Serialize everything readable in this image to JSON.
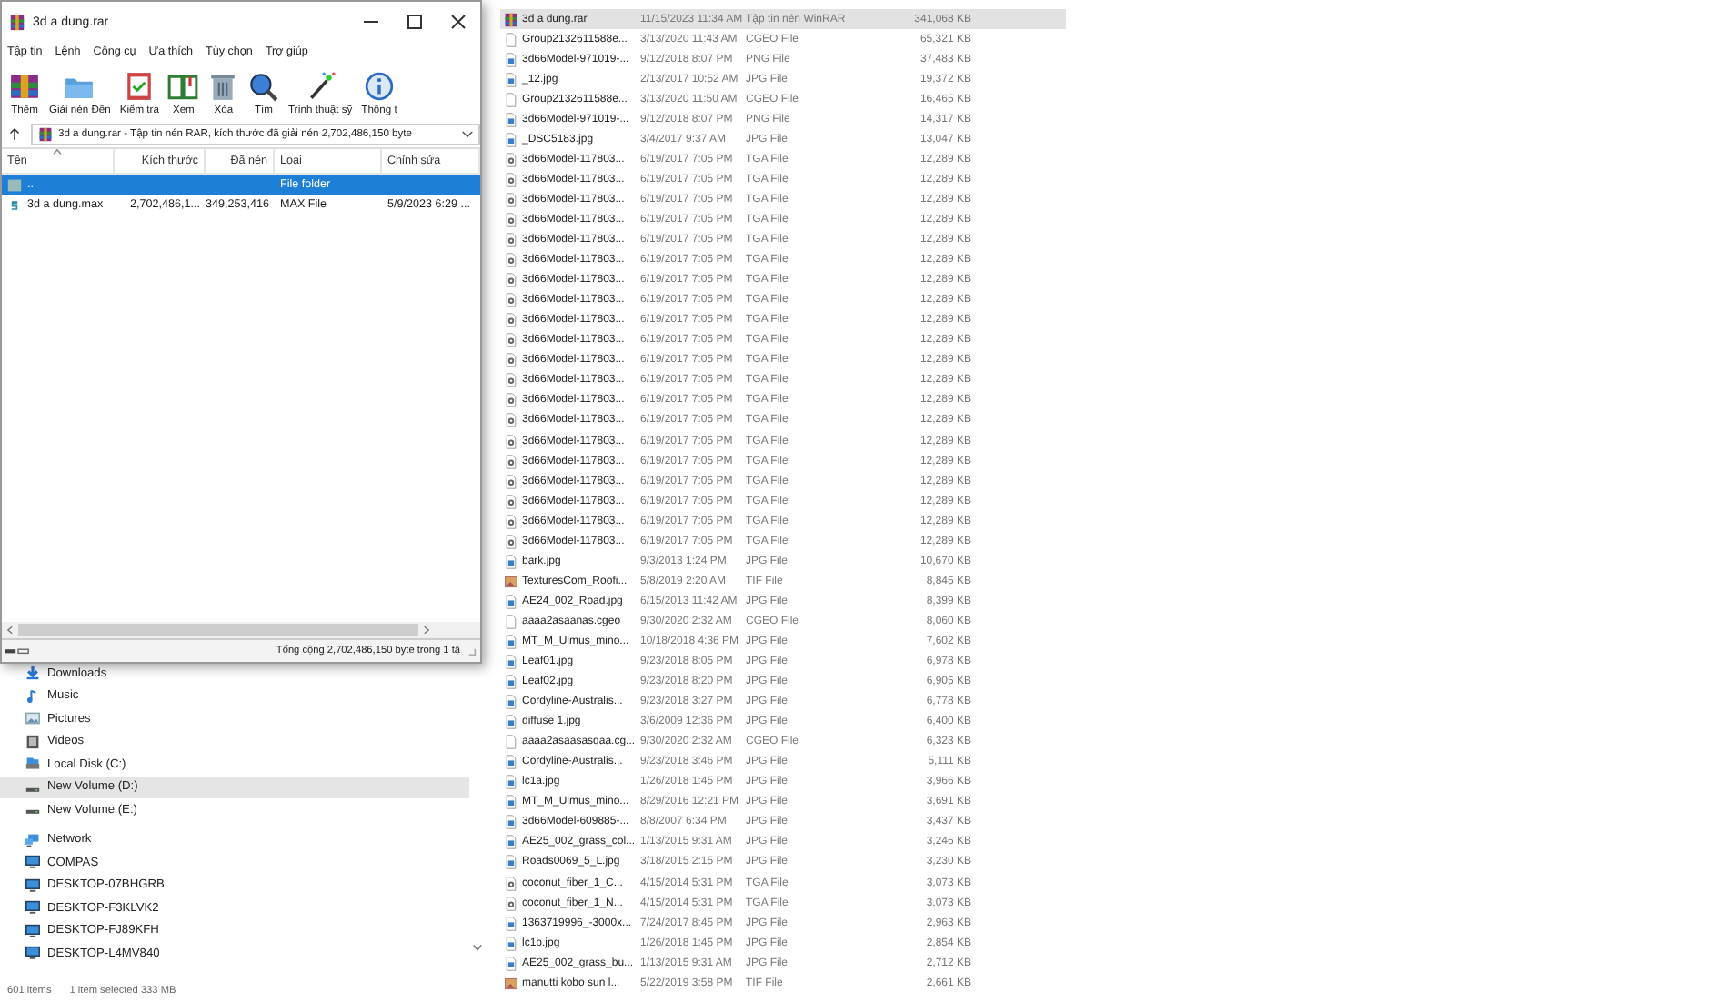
{
  "explorer": {
    "nav_items": [
      {
        "label": "Downloads",
        "kind": "download",
        "selected": false
      },
      {
        "label": "Music",
        "kind": "music",
        "selected": false
      },
      {
        "label": "Pictures",
        "kind": "pictures",
        "selected": false
      },
      {
        "label": "Videos",
        "kind": "videos",
        "selected": false
      },
      {
        "label": "Local Disk (C:)",
        "kind": "disk",
        "selected": false
      },
      {
        "label": "New Volume (D:)",
        "kind": "drive",
        "selected": true
      },
      {
        "label": "New Volume (E:)",
        "kind": "drive",
        "selected": false
      },
      {
        "label": "Network",
        "kind": "network",
        "selected": false,
        "children": [
          {
            "label": "COMPAS",
            "kind": "computer",
            "selected": false
          },
          {
            "label": "DESKTOP-07BHGRB",
            "kind": "computer",
            "selected": false
          },
          {
            "label": "DESKTOP-F3KLVK2",
            "kind": "computer",
            "selected": false
          },
          {
            "label": "DESKTOP-FJ89KFH",
            "kind": "computer",
            "selected": false
          },
          {
            "label": "DESKTOP-L4MV840",
            "kind": "computer",
            "selected": false
          }
        ]
      }
    ],
    "files": [
      {
        "name": "3d a dung.rar",
        "date": "11/15/2023 11:34 AM",
        "type": "Tập tin nén WinRAR",
        "size": "341,068 KB",
        "kind": "rar",
        "selected": true
      },
      {
        "name": "Group2132611588e...",
        "date": "3/13/2020 11:43 AM",
        "type": "CGEO File",
        "size": "65,321 KB",
        "kind": "blank",
        "selected": false
      },
      {
        "name": "3d66Model-971019-...",
        "date": "9/12/2018 8:07 PM",
        "type": "PNG File",
        "size": "37,483 KB",
        "kind": "image",
        "selected": false
      },
      {
        "name": "_12.jpg",
        "date": "2/13/2017 10:52 AM",
        "type": "JPG File",
        "size": "19,372 KB",
        "kind": "image",
        "selected": false
      },
      {
        "name": "Group2132611588e...",
        "date": "3/13/2020 11:50 AM",
        "type": "CGEO File",
        "size": "16,465 KB",
        "kind": "blank",
        "selected": false
      },
      {
        "name": "3d66Model-971019-...",
        "date": "9/12/2018 8:07 PM",
        "type": "PNG File",
        "size": "14,317 KB",
        "kind": "image",
        "selected": false
      },
      {
        "name": "_DSC5183.jpg",
        "date": "3/4/2017 9:37 AM",
        "type": "JPG File",
        "size": "13,047 KB",
        "kind": "image",
        "selected": false
      },
      {
        "name": "3d66Model-117803...",
        "date": "6/19/2017 7:05 PM",
        "type": "TGA File",
        "size": "12,289 KB",
        "kind": "tga",
        "selected": false
      },
      {
        "name": "3d66Model-117803...",
        "date": "6/19/2017 7:05 PM",
        "type": "TGA File",
        "size": "12,289 KB",
        "kind": "tga",
        "selected": false
      },
      {
        "name": "3d66Model-117803...",
        "date": "6/19/2017 7:05 PM",
        "type": "TGA File",
        "size": "12,289 KB",
        "kind": "tga",
        "selected": false
      },
      {
        "name": "3d66Model-117803...",
        "date": "6/19/2017 7:05 PM",
        "type": "TGA File",
        "size": "12,289 KB",
        "kind": "tga",
        "selected": false
      },
      {
        "name": "3d66Model-117803...",
        "date": "6/19/2017 7:05 PM",
        "type": "TGA File",
        "size": "12,289 KB",
        "kind": "tga",
        "selected": false
      },
      {
        "name": "3d66Model-117803...",
        "date": "6/19/2017 7:05 PM",
        "type": "TGA File",
        "size": "12,289 KB",
        "kind": "tga",
        "selected": false
      },
      {
        "name": "3d66Model-117803...",
        "date": "6/19/2017 7:05 PM",
        "type": "TGA File",
        "size": "12,289 KB",
        "kind": "tga",
        "selected": false
      },
      {
        "name": "3d66Model-117803...",
        "date": "6/19/2017 7:05 PM",
        "type": "TGA File",
        "size": "12,289 KB",
        "kind": "tga",
        "selected": false
      },
      {
        "name": "3d66Model-117803...",
        "date": "6/19/2017 7:05 PM",
        "type": "TGA File",
        "size": "12,289 KB",
        "kind": "tga",
        "selected": false
      },
      {
        "name": "3d66Model-117803...",
        "date": "6/19/2017 7:05 PM",
        "type": "TGA File",
        "size": "12,289 KB",
        "kind": "tga",
        "selected": false
      },
      {
        "name": "3d66Model-117803...",
        "date": "6/19/2017 7:05 PM",
        "type": "TGA File",
        "size": "12,289 KB",
        "kind": "tga",
        "selected": false
      },
      {
        "name": "3d66Model-117803...",
        "date": "6/19/2017 7:05 PM",
        "type": "TGA File",
        "size": "12,289 KB",
        "kind": "tga",
        "selected": false
      },
      {
        "name": "3d66Model-117803...",
        "date": "6/19/2017 7:05 PM",
        "type": "TGA File",
        "size": "12,289 KB",
        "kind": "tga",
        "selected": false
      },
      {
        "name": "3d66Model-117803...",
        "date": "6/19/2017 7:05 PM",
        "type": "TGA File",
        "size": "12,289 KB",
        "kind": "tga",
        "selected": false
      },
      {
        "name": "3d66Model-117803...",
        "date": "6/19/2017 7:05 PM",
        "type": "TGA File",
        "size": "12,289 KB",
        "kind": "tga",
        "selected": false
      },
      {
        "name": "3d66Model-117803...",
        "date": "6/19/2017 7:05 PM",
        "type": "TGA File",
        "size": "12,289 KB",
        "kind": "tga",
        "selected": false
      },
      {
        "name": "3d66Model-117803...",
        "date": "6/19/2017 7:05 PM",
        "type": "TGA File",
        "size": "12,289 KB",
        "kind": "tga",
        "selected": false
      },
      {
        "name": "3d66Model-117803...",
        "date": "6/19/2017 7:05 PM",
        "type": "TGA File",
        "size": "12,289 KB",
        "kind": "tga",
        "selected": false
      },
      {
        "name": "3d66Model-117803...",
        "date": "6/19/2017 7:05 PM",
        "type": "TGA File",
        "size": "12,289 KB",
        "kind": "tga",
        "selected": false
      },
      {
        "name": "3d66Model-117803...",
        "date": "6/19/2017 7:05 PM",
        "type": "TGA File",
        "size": "12,289 KB",
        "kind": "tga",
        "selected": false
      },
      {
        "name": "bark.jpg",
        "date": "9/3/2013 1:24 PM",
        "type": "JPG File",
        "size": "10,670 KB",
        "kind": "image",
        "selected": false
      },
      {
        "name": "TexturesCom_Roofi...",
        "date": "5/8/2019 2:20 AM",
        "type": "TIF File",
        "size": "8,845 KB",
        "kind": "tif",
        "selected": false
      },
      {
        "name": "AE24_002_Road.jpg",
        "date": "6/15/2013 11:42 AM",
        "type": "JPG File",
        "size": "8,399 KB",
        "kind": "image",
        "selected": false
      },
      {
        "name": "aaaa2asaanas.cgeo",
        "date": "9/30/2020 2:32 AM",
        "type": "CGEO File",
        "size": "8,060 KB",
        "kind": "blank",
        "selected": false
      },
      {
        "name": "MT_M_Ulmus_mino...",
        "date": "10/18/2018 4:36 PM",
        "type": "JPG File",
        "size": "7,602 KB",
        "kind": "image",
        "selected": false
      },
      {
        "name": "Leaf01.jpg",
        "date": "9/23/2018 8:05 PM",
        "type": "JPG File",
        "size": "6,978 KB",
        "kind": "image",
        "selected": false
      },
      {
        "name": "Leaf02.jpg",
        "date": "9/23/2018 8:20 PM",
        "type": "JPG File",
        "size": "6,905 KB",
        "kind": "image",
        "selected": false
      },
      {
        "name": "Cordyline-Australis...",
        "date": "9/23/2018 3:27 PM",
        "type": "JPG File",
        "size": "6,778 KB",
        "kind": "image",
        "selected": false
      },
      {
        "name": "diffuse 1.jpg",
        "date": "3/6/2009 12:36 PM",
        "type": "JPG File",
        "size": "6,400 KB",
        "kind": "image",
        "selected": false
      },
      {
        "name": "aaaa2asaasasqaa.cg...",
        "date": "9/30/2020 2:32 AM",
        "type": "CGEO File",
        "size": "6,323 KB",
        "kind": "blank",
        "selected": false
      },
      {
        "name": "Cordyline-Australis...",
        "date": "9/23/2018 3:46 PM",
        "type": "JPG File",
        "size": "5,111 KB",
        "kind": "image",
        "selected": false
      },
      {
        "name": "lc1a.jpg",
        "date": "1/26/2018 1:45 PM",
        "type": "JPG File",
        "size": "3,966 KB",
        "kind": "image",
        "selected": false
      },
      {
        "name": "MT_M_Ulmus_mino...",
        "date": "8/29/2016 12:21 PM",
        "type": "JPG File",
        "size": "3,691 KB",
        "kind": "image",
        "selected": false
      },
      {
        "name": "3d66Model-609885-...",
        "date": "8/8/2007 6:34 PM",
        "type": "JPG File",
        "size": "3,437 KB",
        "kind": "image",
        "selected": false
      },
      {
        "name": "AE25_002_grass_col...",
        "date": "1/13/2015 9:31 AM",
        "type": "JPG File",
        "size": "3,246 KB",
        "kind": "image",
        "selected": false
      },
      {
        "name": "Roads0069_5_L.jpg",
        "date": "3/18/2015 2:15 PM",
        "type": "JPG File",
        "size": "3,230 KB",
        "kind": "image",
        "selected": false
      },
      {
        "name": "coconut_fiber_1_C...",
        "date": "4/15/2014 5:31 PM",
        "type": "TGA File",
        "size": "3,073 KB",
        "kind": "tga",
        "selected": false
      },
      {
        "name": "coconut_fiber_1_N...",
        "date": "4/15/2014 5:31 PM",
        "type": "TGA File",
        "size": "3,073 KB",
        "kind": "tga",
        "selected": false
      },
      {
        "name": "1363719996_-3000x...",
        "date": "7/24/2017 8:45 PM",
        "type": "JPG File",
        "size": "2,963 KB",
        "kind": "image",
        "selected": false
      },
      {
        "name": "lc1b.jpg",
        "date": "1/26/2018 1:45 PM",
        "type": "JPG File",
        "size": "2,854 KB",
        "kind": "image",
        "selected": false
      },
      {
        "name": "AE25_002_grass_bu...",
        "date": "1/13/2015 9:31 AM",
        "type": "JPG File",
        "size": "2,712 KB",
        "kind": "image",
        "selected": false
      },
      {
        "name": "manutti kobo sun l...",
        "date": "5/22/2019 3:58 PM",
        "type": "TIF File",
        "size": "2,661 KB",
        "kind": "tif",
        "selected": false
      }
    ],
    "status": [
      "601 items",
      "1 item selected  333 MB"
    ]
  },
  "winrar": {
    "title": "3d a dung.rar",
    "menu": [
      "Tập tin",
      "Lệnh",
      "Công cụ",
      "Ưa thích",
      "Tùy chọn",
      "Trợ giúp"
    ],
    "toolbar": [
      {
        "label": "Thêm",
        "kind": "add"
      },
      {
        "label": "Giải nén Đến",
        "kind": "extract"
      },
      {
        "label": "Kiểm tra",
        "kind": "test"
      },
      {
        "label": "Xem",
        "kind": "view"
      },
      {
        "label": "Xóa",
        "kind": "delete"
      },
      {
        "label": "Tìm",
        "kind": "find"
      },
      {
        "label": "Trình thuật sỹ",
        "kind": "wizard"
      },
      {
        "label": "Thông t",
        "kind": "info"
      }
    ],
    "address": "3d a dung.rar - Tập tin nén RAR, kích thước đã giải nén 2,702,486,150 byte",
    "columns": [
      "Tên",
      "Kích thước",
      "Đã nén",
      "Loại",
      "Chỉnh sửa"
    ],
    "rows": [
      {
        "name": "..",
        "size": "",
        "packed": "",
        "type": "File folder",
        "modified": "",
        "kind": "folder",
        "selected": true
      },
      {
        "name": "3d a dung.max",
        "size": "2,702,486,1...",
        "packed": "349,253,416",
        "type": "MAX File",
        "modified": "5/9/2023 6:29 ...",
        "kind": "file",
        "selected": false
      }
    ],
    "status": "Tổng cộng 2,702,486,150 byte trong 1 tậ"
  }
}
